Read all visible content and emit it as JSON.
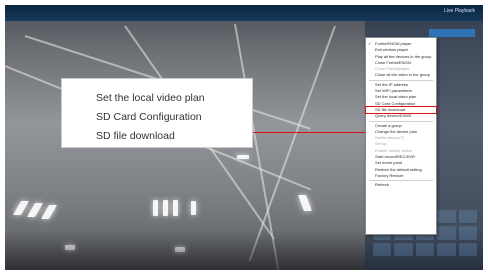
{
  "top_links": "Live   Playback",
  "panel_header": "",
  "callout": {
    "lines": [
      "Set the local video plan",
      "SD Card Configuration",
      "SD file download"
    ]
  },
  "context_menu": {
    "items": [
      {
        "label": "Forbid/ENGM player",
        "state": "checked"
      },
      {
        "label": "Exit window player",
        "state": "normal"
      },
      {
        "label": "Play all the devices in the group",
        "state": "normal"
      },
      {
        "label": "Close Forbid/ENGM",
        "state": "normal"
      },
      {
        "label": "Close Forbid/player",
        "state": "disabled"
      },
      {
        "label": "Close all the video in the group",
        "state": "normal"
      },
      {
        "label": "Set the IP address",
        "state": "normal"
      },
      {
        "label": "Set WIFI parameters",
        "state": "normal"
      },
      {
        "label": "Set the local video plan",
        "state": "normal"
      },
      {
        "label": "SD Card Configuration",
        "state": "normal"
      },
      {
        "label": "SD file download",
        "state": "highlight"
      },
      {
        "label": "Query device/DVMS",
        "state": "normal"
      },
      {
        "label": "Create a group",
        "state": "normal"
      },
      {
        "label": "Change the device plan",
        "state": "normal"
      },
      {
        "label": "Delete device(T)",
        "state": "disabled"
      },
      {
        "label": "Set up",
        "state": "disabled"
      },
      {
        "label": "Enable mobile detect",
        "state": "disabled"
      },
      {
        "label": "Start record/REC/DVR",
        "state": "normal"
      },
      {
        "label": "Set dome point",
        "state": "normal"
      },
      {
        "label": "Restore the default setting",
        "state": "normal"
      },
      {
        "label": "Factory Restore",
        "state": "normal"
      },
      {
        "label": "Refresh",
        "state": "normal"
      }
    ]
  },
  "colors": {
    "highlight": "#e01010",
    "topbar": "#0b2540",
    "menu_bg": "#ffffff"
  }
}
